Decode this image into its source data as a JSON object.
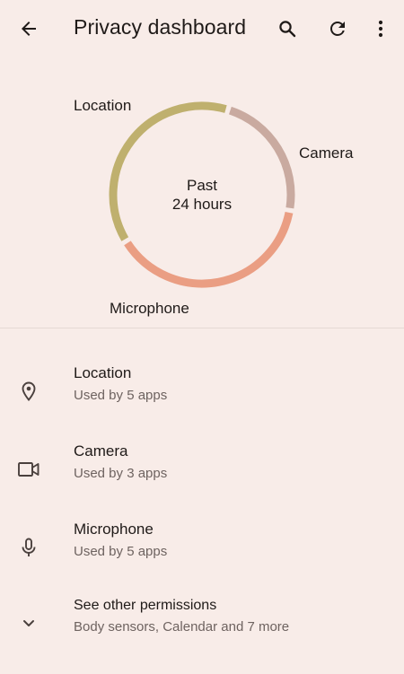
{
  "app_bar": {
    "title": "Privacy dashboard",
    "back_icon": "arrow-back-icon",
    "search_icon": "search-icon",
    "refresh_icon": "refresh-icon",
    "more_icon": "more-vert-icon"
  },
  "chart_data": {
    "type": "pie",
    "center_label_line1": "Past",
    "center_label_line2": "24 hours",
    "labels": [
      "Location",
      "Camera",
      "Microphone"
    ],
    "values": [
      5,
      3,
      5
    ],
    "colors": [
      "#bfb06e",
      "#c9aaa0",
      "#ea9e83"
    ]
  },
  "permissions": [
    {
      "label": "Location",
      "detail": "Used by 5 apps",
      "icon": "location-pin-icon"
    },
    {
      "label": "Camera",
      "detail": "Used by 3 apps",
      "icon": "videocam-icon"
    },
    {
      "label": "Microphone",
      "detail": "Used by 5 apps",
      "icon": "mic-icon"
    }
  ],
  "other_permissions": {
    "label": "See other permissions",
    "detail": "Body sensors, Calendar and 7 more",
    "icon": "chevron-down-icon"
  },
  "colors": {
    "background": "#f8ece8",
    "text_primary": "#1f1a18",
    "text_secondary": "#6e6360"
  }
}
